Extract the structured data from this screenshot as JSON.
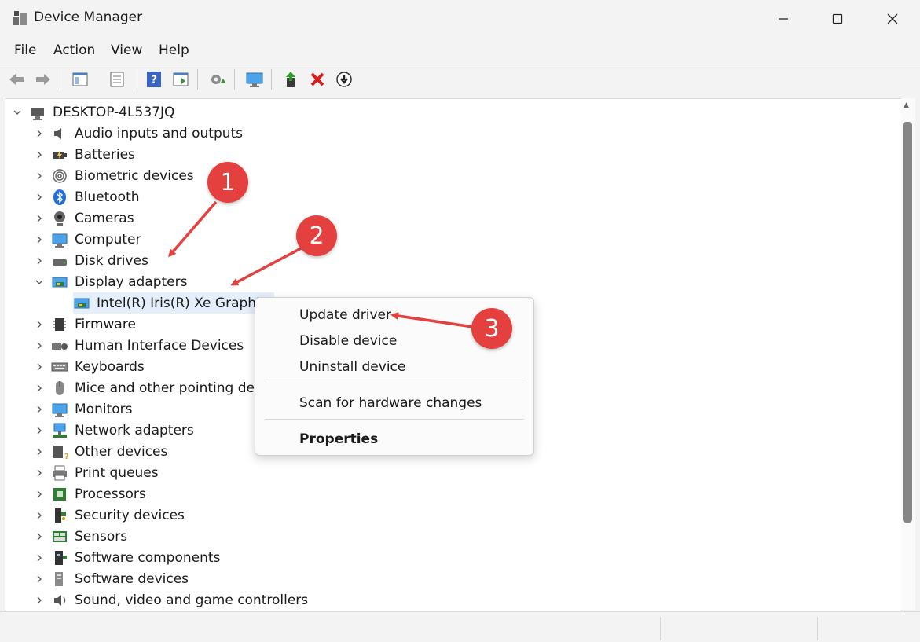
{
  "window": {
    "title": "Device Manager",
    "app_icon": "device-manager-icon"
  },
  "menu": [
    "File",
    "Action",
    "View",
    "Help"
  ],
  "toolbar_icons": [
    "back-arrow-icon",
    "forward-arrow-icon",
    "properties-icon",
    "details-icon",
    "help-icon",
    "action-view-icon",
    "scan-hardware-icon",
    "monitor-icon",
    "update-driver-icon",
    "uninstall-icon",
    "download-icon"
  ],
  "tree": {
    "root": "DESKTOP-4L537JQ",
    "categories": [
      {
        "label": "Audio inputs and outputs",
        "icon": "speaker-icon"
      },
      {
        "label": "Batteries",
        "icon": "battery-icon"
      },
      {
        "label": "Biometric devices",
        "icon": "fingerprint-icon"
      },
      {
        "label": "Bluetooth",
        "icon": "bluetooth-icon"
      },
      {
        "label": "Cameras",
        "icon": "camera-icon"
      },
      {
        "label": "Computer",
        "icon": "computer-icon"
      },
      {
        "label": "Disk drives",
        "icon": "disk-icon"
      },
      {
        "label": "Display adapters",
        "icon": "display-adapter-icon",
        "expanded": true
      },
      {
        "label": "Intel(R) Iris(R) Xe Graphics",
        "icon": "display-adapter-icon",
        "child": true
      },
      {
        "label": "Firmware",
        "icon": "chip-icon"
      },
      {
        "label": "Human Interface Devices",
        "icon": "hid-icon"
      },
      {
        "label": "Keyboards",
        "icon": "keyboard-icon"
      },
      {
        "label": "Mice and other pointing dev",
        "icon": "mouse-icon"
      },
      {
        "label": "Monitors",
        "icon": "monitor-icon"
      },
      {
        "label": "Network adapters",
        "icon": "network-icon"
      },
      {
        "label": "Other devices",
        "icon": "unknown-device-icon"
      },
      {
        "label": "Print queues",
        "icon": "printer-icon"
      },
      {
        "label": "Processors",
        "icon": "processor-icon"
      },
      {
        "label": "Security devices",
        "icon": "security-icon"
      },
      {
        "label": "Sensors",
        "icon": "sensor-icon"
      },
      {
        "label": "Software components",
        "icon": "software-component-icon"
      },
      {
        "label": "Software devices",
        "icon": "software-device-icon"
      },
      {
        "label": "Sound, video and game controllers",
        "icon": "sound-icon"
      }
    ]
  },
  "context_menu": {
    "items": [
      "Update driver",
      "Disable device",
      "Uninstall device",
      "Scan for hardware changes",
      "Properties"
    ]
  },
  "annotations": [
    "1",
    "2",
    "3"
  ],
  "colors": {
    "annotation": "#e4403f",
    "selection": "#e5eefb",
    "accent": "#0078d4"
  }
}
